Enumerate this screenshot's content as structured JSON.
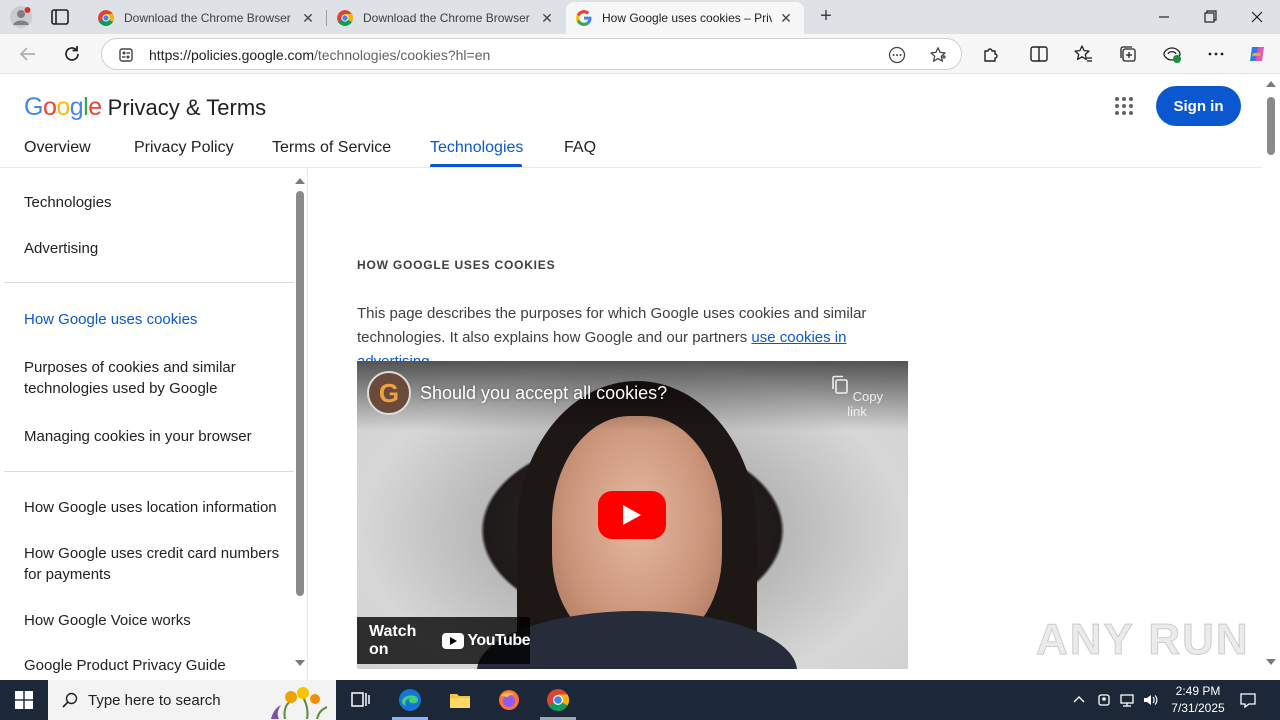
{
  "browser": {
    "tabs": [
      {
        "title": "Download the Chrome Browser for",
        "favicon": "chrome-icon",
        "active": false
      },
      {
        "title": "Download the Chrome Browser for",
        "favicon": "chrome-icon",
        "active": false
      },
      {
        "title": "How Google uses cookies – Privacy",
        "favicon": "google-icon",
        "active": true
      }
    ],
    "url_host": "https://policies.google.com",
    "url_path": "/technologies/cookies?hl=en"
  },
  "header": {
    "logo_text": "Google",
    "site_title": "Privacy & Terms",
    "signin_label": "Sign in"
  },
  "mainnav": {
    "items": [
      "Overview",
      "Privacy Policy",
      "Terms of Service",
      "Technologies",
      "FAQ"
    ],
    "active": "Technologies"
  },
  "sidebar": {
    "groups": [
      [
        "Technologies",
        "Advertising"
      ],
      [
        "How Google uses cookies",
        "Purposes of cookies and similar technologies used by Google",
        "Managing cookies in your browser"
      ],
      [
        "How Google uses location information",
        "How Google uses credit card numbers for payments",
        "How Google Voice works",
        "Google Product Privacy Guide"
      ]
    ],
    "active": "How Google uses cookies"
  },
  "content": {
    "eyebrow": "HOW GOOGLE USES COOKIES",
    "para_before": "This page describes the purposes for which Google uses cookies and similar technologies. It also explains how Google and our partners ",
    "para_link": "use cookies in advertising",
    "para_after": "."
  },
  "video": {
    "title": "Should you accept all cookies?",
    "copy_label": "Copy link",
    "watch_label": "Watch on",
    "youtube_label": "YouTube",
    "channel_initial": "G"
  },
  "watermark": "ANY RUN",
  "taskbar": {
    "search_placeholder": "Type here to search",
    "time": "2:49 PM",
    "date": "7/31/2025"
  },
  "colors": {
    "accent": "#0b57d0",
    "taskbar": "#1c2737"
  }
}
